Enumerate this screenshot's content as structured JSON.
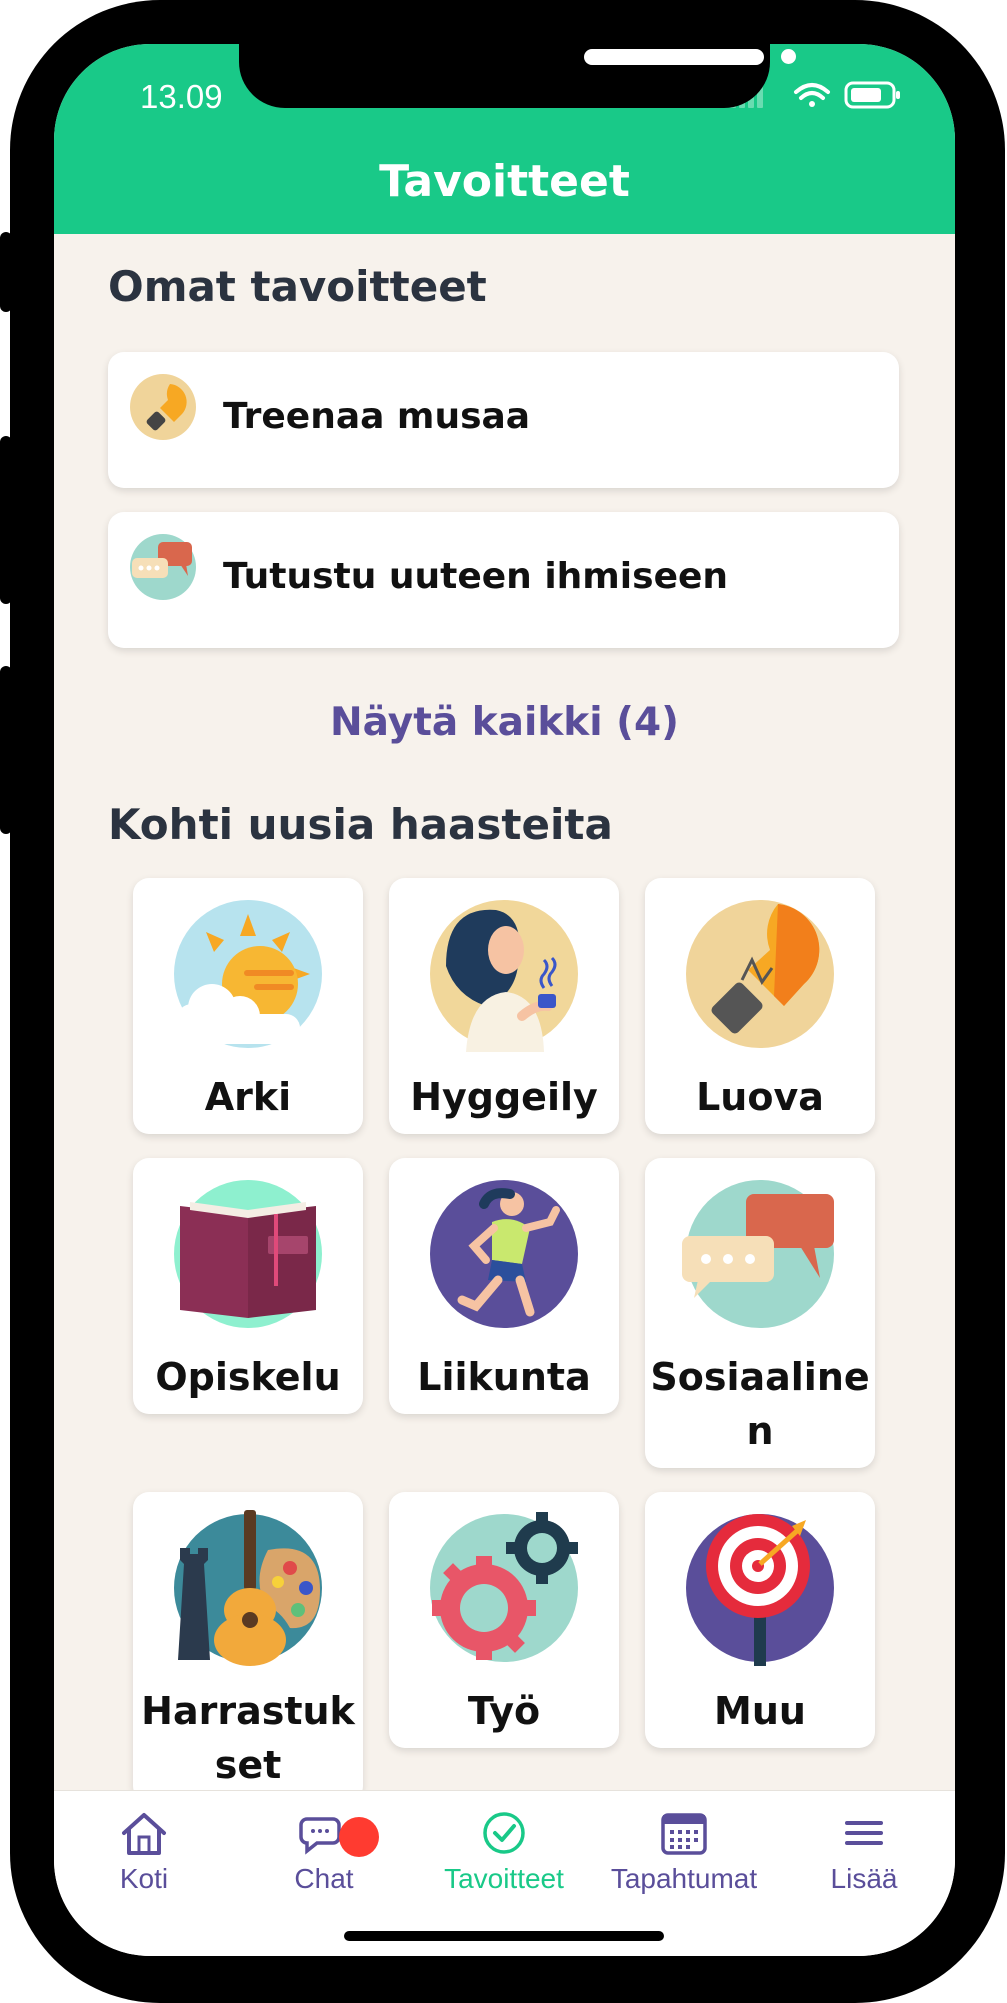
{
  "status_bar": {
    "time": "13.09"
  },
  "header": {
    "title": "Tavoitteet"
  },
  "my_goals": {
    "title": "Omat tavoitteet",
    "items": [
      {
        "label": "Treenaa musaa",
        "icon": "lightbulb-icon"
      },
      {
        "label": "Tutustu uuteen ihmiseen",
        "icon": "chat-bubbles-icon"
      }
    ],
    "show_all": "Näytä kaikki (4)"
  },
  "challenges": {
    "title": "Kohti uusia haasteita",
    "tiles": [
      {
        "label": "Arki",
        "icon": "sun-cloud-icon"
      },
      {
        "label": "Hyggeily",
        "icon": "woman-coffee-icon"
      },
      {
        "label": "Luova",
        "icon": "lightbulb-icon"
      },
      {
        "label": "Opiskelu",
        "icon": "book-icon"
      },
      {
        "label": "Liikunta",
        "icon": "runner-icon"
      },
      {
        "label": "Sosiaalinen",
        "icon": "chat-bubbles-icon"
      },
      {
        "label": "Harrastukset",
        "icon": "guitar-palette-icon"
      },
      {
        "label": "Työ",
        "icon": "gears-icon"
      },
      {
        "label": "Muu",
        "icon": "target-icon"
      }
    ]
  },
  "tabbar": {
    "items": [
      {
        "label": "Koti",
        "icon": "home-icon"
      },
      {
        "label": "Chat",
        "icon": "chat-icon"
      },
      {
        "label": "Tavoitteet",
        "icon": "check-circle-icon",
        "active": true
      },
      {
        "label": "Tapahtumat",
        "icon": "calendar-icon"
      },
      {
        "label": "Lisää",
        "icon": "menu-icon"
      }
    ]
  },
  "colors": {
    "brand": "#19c988",
    "accent": "#5a4e9a",
    "background": "#f7f2ec",
    "badge": "#ff3b30"
  }
}
